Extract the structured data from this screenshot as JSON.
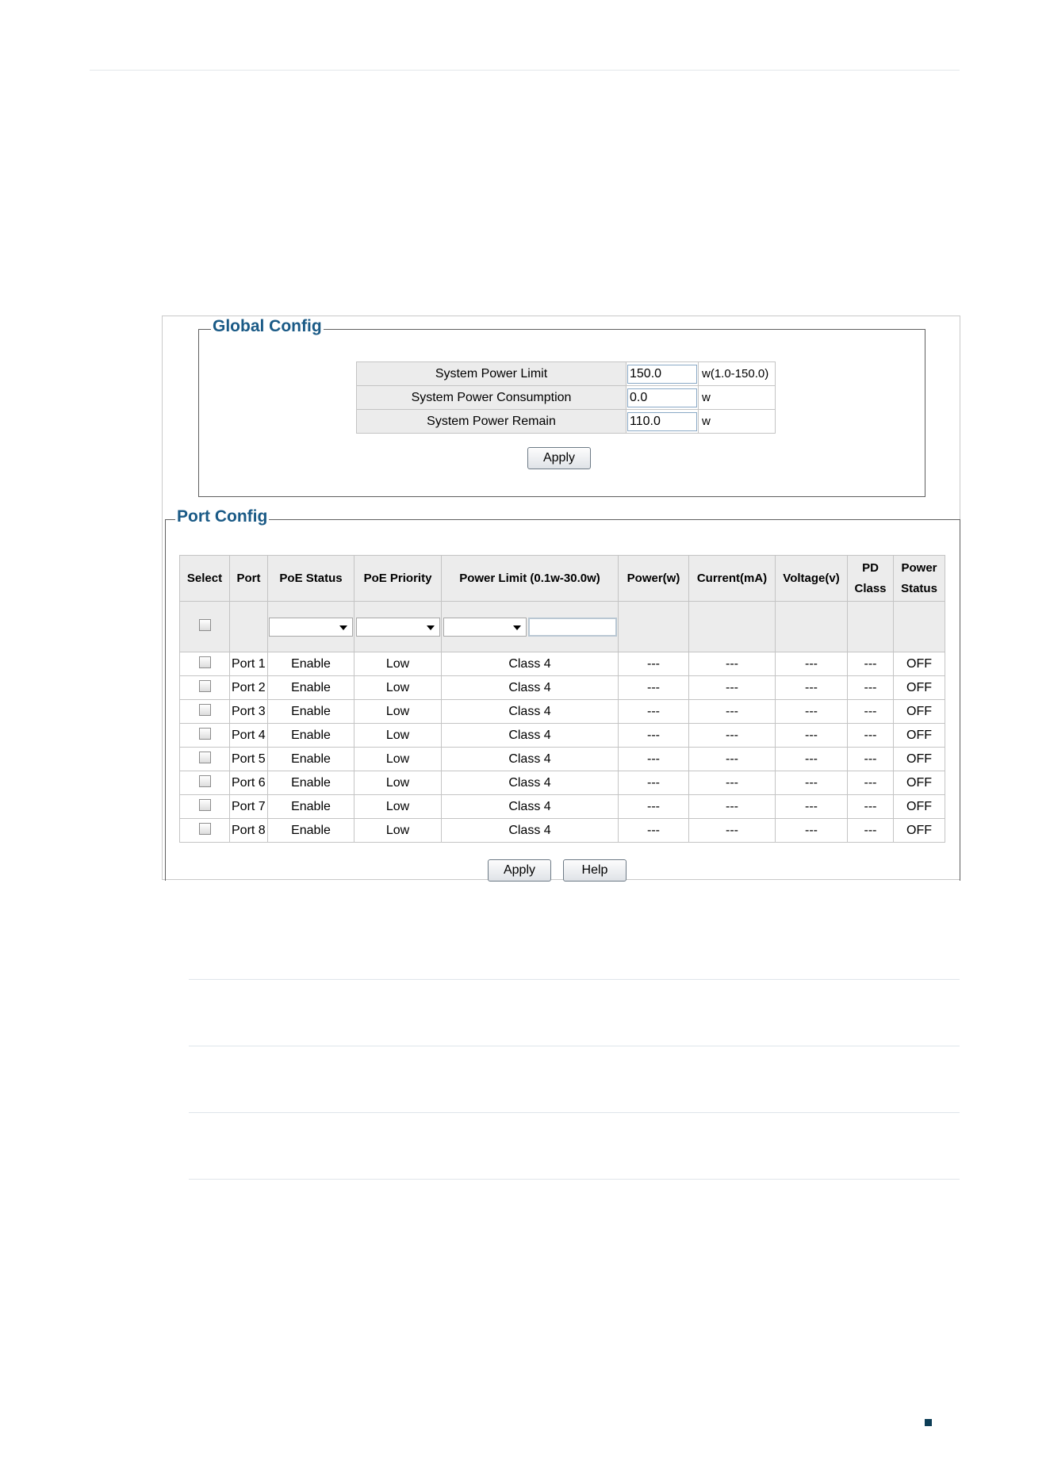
{
  "global": {
    "legend": "Global Config",
    "rows": [
      {
        "label": "System Power Limit",
        "value": "150.0",
        "unit": "w(1.0-150.0)"
      },
      {
        "label": "System Power Consumption",
        "value": "0.0",
        "unit": "w"
      },
      {
        "label": "System Power Remain",
        "value": "110.0",
        "unit": "w"
      }
    ],
    "apply_label": "Apply"
  },
  "port": {
    "legend": "Port Config",
    "headers": {
      "select": "Select",
      "port": "Port",
      "poe_status": "PoE Status",
      "poe_priority": "PoE Priority",
      "power_limit": "Power Limit (0.1w-30.0w)",
      "power": "Power(w)",
      "current": "Current(mA)",
      "voltage": "Voltage(v)",
      "pd_class_1": "PD",
      "pd_class_2": "Class",
      "power_status_1": "Power",
      "power_status_2": "Status"
    },
    "rows": [
      {
        "port": "Port 1",
        "status": "Enable",
        "priority": "Low",
        "limit": "Class 4",
        "power": "---",
        "current": "---",
        "voltage": "---",
        "pd": "---",
        "pstatus": "OFF"
      },
      {
        "port": "Port 2",
        "status": "Enable",
        "priority": "Low",
        "limit": "Class 4",
        "power": "---",
        "current": "---",
        "voltage": "---",
        "pd": "---",
        "pstatus": "OFF"
      },
      {
        "port": "Port 3",
        "status": "Enable",
        "priority": "Low",
        "limit": "Class 4",
        "power": "---",
        "current": "---",
        "voltage": "---",
        "pd": "---",
        "pstatus": "OFF"
      },
      {
        "port": "Port 4",
        "status": "Enable",
        "priority": "Low",
        "limit": "Class 4",
        "power": "---",
        "current": "---",
        "voltage": "---",
        "pd": "---",
        "pstatus": "OFF"
      },
      {
        "port": "Port 5",
        "status": "Enable",
        "priority": "Low",
        "limit": "Class 4",
        "power": "---",
        "current": "---",
        "voltage": "---",
        "pd": "---",
        "pstatus": "OFF"
      },
      {
        "port": "Port 6",
        "status": "Enable",
        "priority": "Low",
        "limit": "Class 4",
        "power": "---",
        "current": "---",
        "voltage": "---",
        "pd": "---",
        "pstatus": "OFF"
      },
      {
        "port": "Port 7",
        "status": "Enable",
        "priority": "Low",
        "limit": "Class 4",
        "power": "---",
        "current": "---",
        "voltage": "---",
        "pd": "---",
        "pstatus": "OFF"
      },
      {
        "port": "Port 8",
        "status": "Enable",
        "priority": "Low",
        "limit": "Class 4",
        "power": "---",
        "current": "---",
        "voltage": "---",
        "pd": "---",
        "pstatus": "OFF"
      }
    ],
    "apply_label": "Apply",
    "help_label": "Help"
  },
  "colors": {
    "legend": "#1a5a86",
    "page_mark": "#0d3d56"
  }
}
